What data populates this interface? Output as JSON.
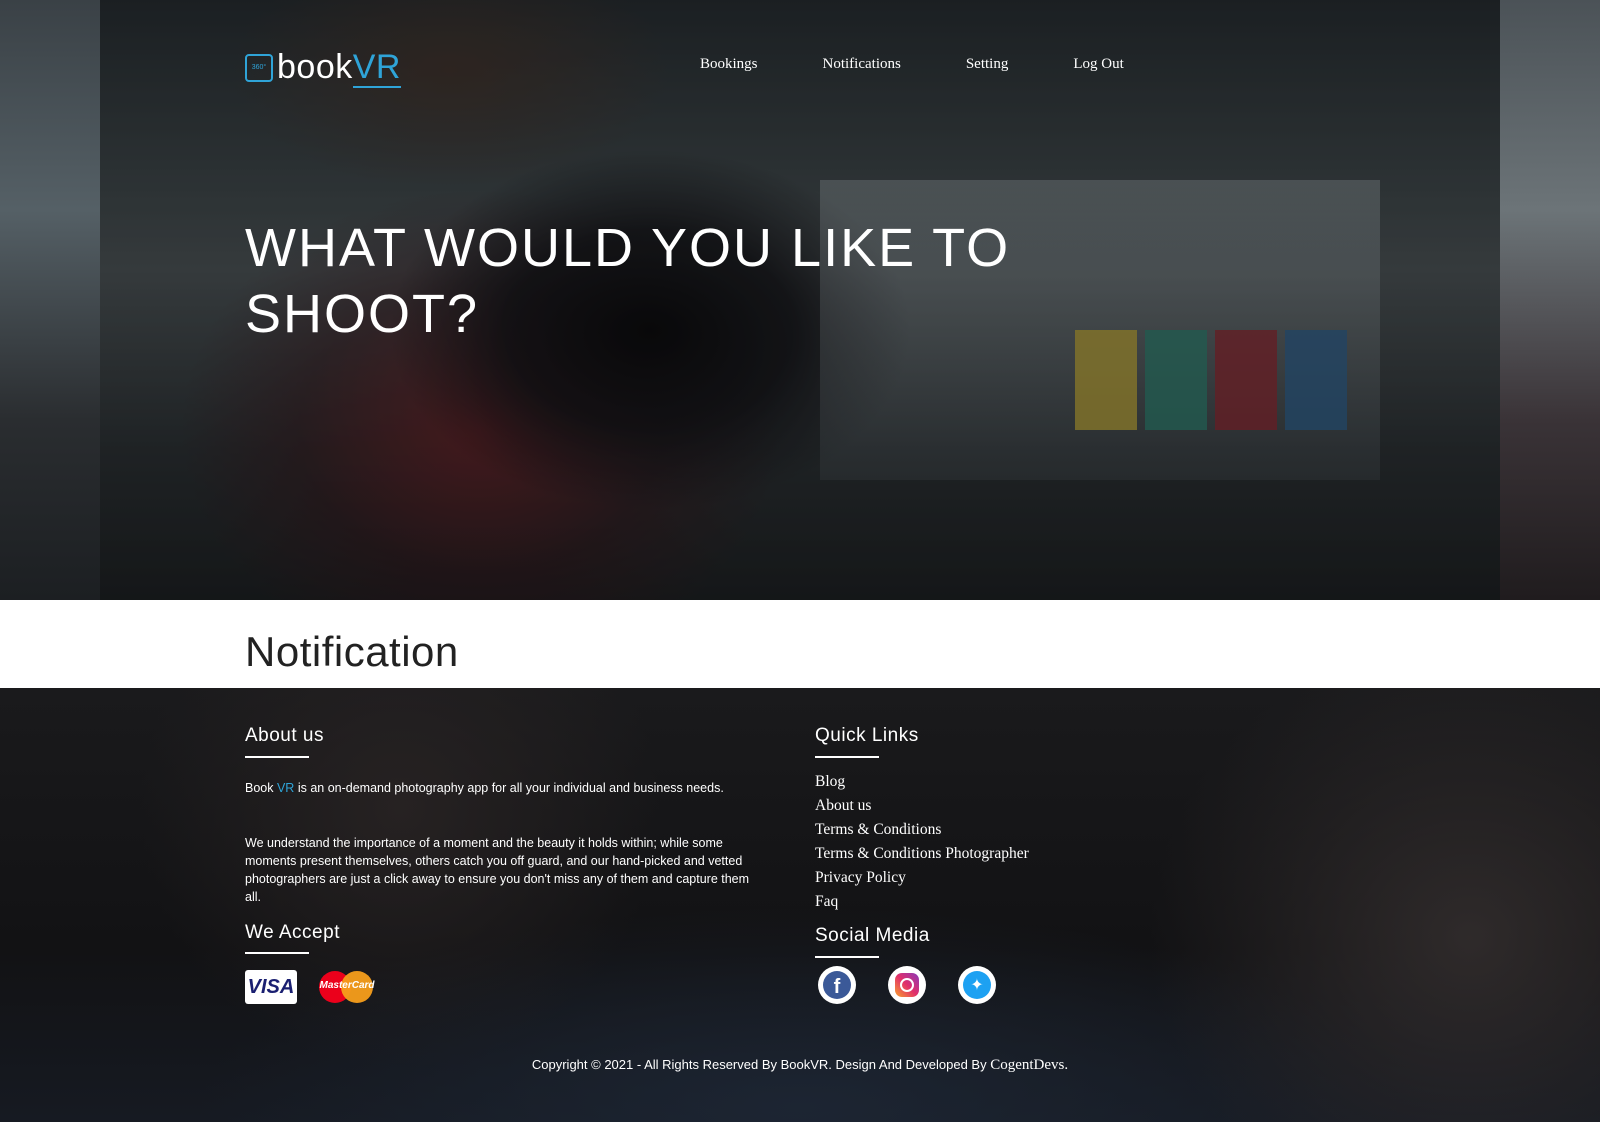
{
  "header": {
    "logo_prefix": "book",
    "logo_suffix": "VR",
    "logo_badge": "360°",
    "nav": [
      "Bookings",
      "Notifications",
      "Setting",
      "Log Out"
    ]
  },
  "hero": {
    "title_line1": "WHAT WOULD YOU LIKE TO",
    "title_line2": "SHOOT?"
  },
  "main": {
    "page_title": "Notification"
  },
  "footer": {
    "about_title": "About us",
    "about_p1_prefix": "Book ",
    "about_p1_accent": "VR",
    "about_p1_suffix": " is an on-demand photography app for all your individual and business needs.",
    "about_p2": "We understand the importance of a moment and the beauty it holds within; while some moments present themselves, others catch you off guard, and our hand-picked and vetted photographers are just a click away to ensure you don't miss any of them and capture them all.",
    "accept_title": "We Accept",
    "cards": [
      "VISA",
      "MasterCard"
    ],
    "quick_links_title": "Quick Links",
    "quick_links": [
      "Blog",
      "About us",
      "Terms & Conditions",
      "Terms & Conditions Photographer",
      "Privacy Policy",
      "Faq"
    ],
    "social_title": "Social Media",
    "social_icons": [
      "facebook-icon",
      "instagram-icon",
      "twitter-icon"
    ],
    "copyright_prefix": "Copyright © 2021 - All Rights Reserved By BookVR. Design And Developed By ",
    "copyright_brand": "CogentDevs."
  },
  "colors": {
    "accent": "#2fa4d8",
    "footer_bg": "#141416",
    "text_light": "#ffffff"
  }
}
